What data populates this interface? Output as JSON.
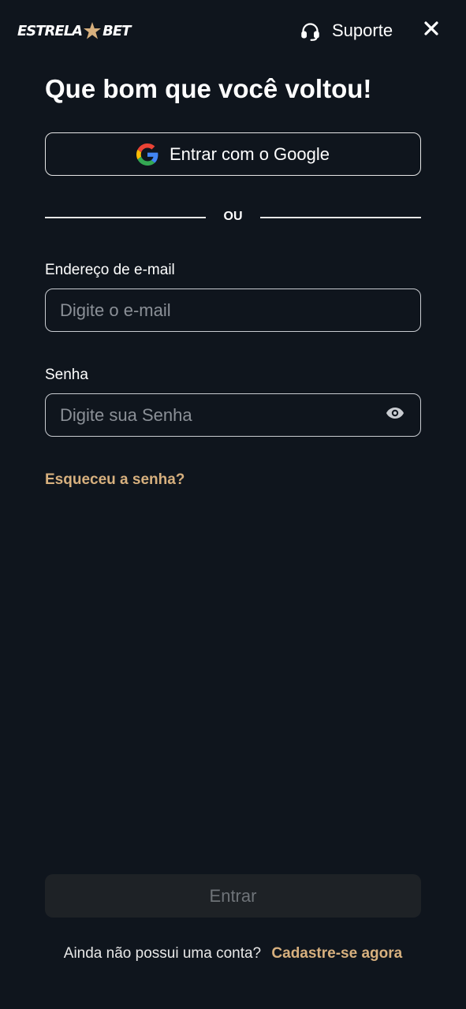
{
  "header": {
    "logo_left": "ESTRELA",
    "logo_right": "BET",
    "support_label": "Suporte",
    "icons": {
      "logo_star": "star-icon",
      "support": "headset-icon",
      "close": "close-icon"
    }
  },
  "login": {
    "title": "Que bom que você voltou!",
    "google_label": "Entrar com o Google",
    "divider_text": "OU",
    "email": {
      "label": "Endereço de e-mail",
      "placeholder": "Digite o e-mail",
      "value": ""
    },
    "password": {
      "label": "Senha",
      "placeholder": "Digite sua Senha",
      "value": ""
    },
    "forgot_label": "Esqueceu a senha?",
    "submit_label": "Entrar",
    "signup_prompt": "Ainda não possui uma conta?",
    "signup_link": "Cadastre-se agora"
  },
  "colors": {
    "background": "#0f151d",
    "accent": "#d7b07e",
    "submit_disabled_bg": "#1e2226",
    "submit_disabled_text": "#6e7378",
    "border": "#c9ccd1"
  }
}
